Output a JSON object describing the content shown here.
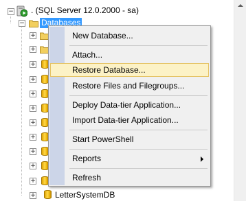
{
  "tree": {
    "server_label": ". (SQL Server 12.0.2000 - sa)",
    "databases_label": "Databases",
    "collapse_glyph": "−",
    "expand_glyph": "+",
    "partial_row_label": "LetterSystemDB",
    "partial_row_label_hidden": "",
    "last_row_label": "LetterSystemDB"
  },
  "menu": {
    "items": [
      {
        "label": "New Database..."
      },
      {
        "label": "Attach..."
      },
      {
        "label": "Restore Database..."
      },
      {
        "label": "Restore Files and Filegroups..."
      },
      {
        "label": "Deploy Data-tier Application..."
      },
      {
        "label": "Import Data-tier Application..."
      },
      {
        "label": "Start PowerShell"
      },
      {
        "label": "Reports"
      },
      {
        "label": "Refresh"
      }
    ],
    "hovered_item": "Restore Database..."
  },
  "colors": {
    "selection": "#3399ff",
    "menu_hover_bg": "#fcf2c6",
    "menu_hover_border": "#e5c365",
    "menu_bg": "#f0f0f0",
    "gutter": "#ccd5e8",
    "server_icon_green": "#2e9c2e",
    "db_icon_gold": "#ffd84a"
  },
  "icons": [
    "collapse-icon",
    "server-icon",
    "folder-icon",
    "database-icon",
    "scroll-up-arrow-icon",
    "submenu-arrow-icon"
  ]
}
